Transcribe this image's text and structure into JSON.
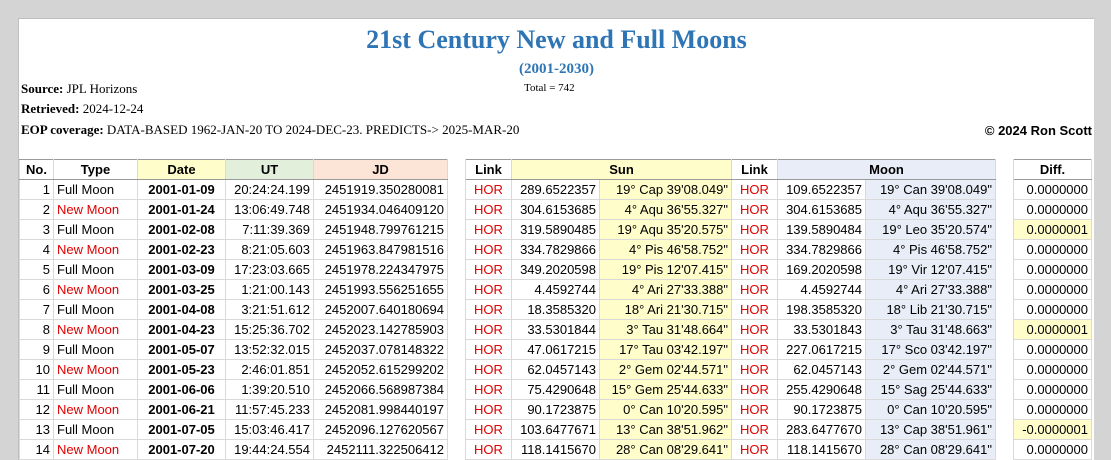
{
  "title": "21st Century New and Full Moons",
  "subtitle": "(2001-2030)",
  "total": "Total = 742",
  "source_label": "Source:",
  "source_value": "JPL Horizons",
  "retrieved_label": "Retrieved:",
  "retrieved_value": "2024-12-24",
  "eop_label": "EOP coverage:",
  "eop_value": "DATA-BASED 1962-JAN-20 TO 2024-DEC-23. PREDICTS-> 2025-MAR-20",
  "copyright": "© 2024 Ron Scott",
  "headers": {
    "no": "No.",
    "type": "Type",
    "date": "Date",
    "ut": "UT",
    "jd": "JD",
    "link1": "Link",
    "sun": "Sun",
    "link2": "Link",
    "moon": "Moon",
    "diff": "Diff."
  },
  "rows": [
    {
      "no": "1",
      "type": "Full Moon",
      "date": "2001-01-09",
      "ut": "20:24:24.199",
      "jd": "2451919.350280081",
      "link1": "HOR",
      "sun_deg": "289.6522357",
      "sun_pos": "19° Cap 39'08.049\"",
      "link2": "HOR",
      "moon_deg": "109.6522357",
      "moon_pos": "19° Can 39'08.049\"",
      "diff": "0.0000000"
    },
    {
      "no": "2",
      "type": "New Moon",
      "date": "2001-01-24",
      "ut": "13:06:49.748",
      "jd": "2451934.046409120",
      "link1": "HOR",
      "sun_deg": "304.6153685",
      "sun_pos": "4° Aqu 36'55.327\"",
      "link2": "HOR",
      "moon_deg": "304.6153685",
      "moon_pos": "4° Aqu 36'55.327\"",
      "diff": "0.0000000"
    },
    {
      "no": "3",
      "type": "Full Moon",
      "date": "2001-02-08",
      "ut": "7:11:39.369",
      "jd": "2451948.799761215",
      "link1": "HOR",
      "sun_deg": "319.5890485",
      "sun_pos": "19° Aqu 35'20.575\"",
      "link2": "HOR",
      "moon_deg": "139.5890484",
      "moon_pos": "19° Leo 35'20.574\"",
      "diff": "0.0000001"
    },
    {
      "no": "4",
      "type": "New Moon",
      "date": "2001-02-23",
      "ut": "8:21:05.603",
      "jd": "2451963.847981516",
      "link1": "HOR",
      "sun_deg": "334.7829866",
      "sun_pos": "4° Pis 46'58.752\"",
      "link2": "HOR",
      "moon_deg": "334.7829866",
      "moon_pos": "4° Pis 46'58.752\"",
      "diff": "0.0000000"
    },
    {
      "no": "5",
      "type": "Full Moon",
      "date": "2001-03-09",
      "ut": "17:23:03.665",
      "jd": "2451978.224347975",
      "link1": "HOR",
      "sun_deg": "349.2020598",
      "sun_pos": "19° Pis 12'07.415\"",
      "link2": "HOR",
      "moon_deg": "169.2020598",
      "moon_pos": "19° Vir 12'07.415\"",
      "diff": "0.0000000"
    },
    {
      "no": "6",
      "type": "New Moon",
      "date": "2001-03-25",
      "ut": "1:21:00.143",
      "jd": "2451993.556251655",
      "link1": "HOR",
      "sun_deg": "4.4592744",
      "sun_pos": "4° Ari 27'33.388\"",
      "link2": "HOR",
      "moon_deg": "4.4592744",
      "moon_pos": "4° Ari 27'33.388\"",
      "diff": "0.0000000"
    },
    {
      "no": "7",
      "type": "Full Moon",
      "date": "2001-04-08",
      "ut": "3:21:51.612",
      "jd": "2452007.640180694",
      "link1": "HOR",
      "sun_deg": "18.3585320",
      "sun_pos": "18° Ari 21'30.715\"",
      "link2": "HOR",
      "moon_deg": "198.3585320",
      "moon_pos": "18° Lib 21'30.715\"",
      "diff": "0.0000000"
    },
    {
      "no": "8",
      "type": "New Moon",
      "date": "2001-04-23",
      "ut": "15:25:36.702",
      "jd": "2452023.142785903",
      "link1": "HOR",
      "sun_deg": "33.5301844",
      "sun_pos": "3° Tau 31'48.664\"",
      "link2": "HOR",
      "moon_deg": "33.5301843",
      "moon_pos": "3° Tau 31'48.663\"",
      "diff": "0.0000001"
    },
    {
      "no": "9",
      "type": "Full Moon",
      "date": "2001-05-07",
      "ut": "13:52:32.015",
      "jd": "2452037.078148322",
      "link1": "HOR",
      "sun_deg": "47.0617215",
      "sun_pos": "17° Tau 03'42.197\"",
      "link2": "HOR",
      "moon_deg": "227.0617215",
      "moon_pos": "17° Sco 03'42.197\"",
      "diff": "0.0000000"
    },
    {
      "no": "10",
      "type": "New Moon",
      "date": "2001-05-23",
      "ut": "2:46:01.851",
      "jd": "2452052.615299202",
      "link1": "HOR",
      "sun_deg": "62.0457143",
      "sun_pos": "2° Gem 02'44.571\"",
      "link2": "HOR",
      "moon_deg": "62.0457143",
      "moon_pos": "2° Gem 02'44.571\"",
      "diff": "0.0000000"
    },
    {
      "no": "11",
      "type": "Full Moon",
      "date": "2001-06-06",
      "ut": "1:39:20.510",
      "jd": "2452066.568987384",
      "link1": "HOR",
      "sun_deg": "75.4290648",
      "sun_pos": "15° Gem 25'44.633\"",
      "link2": "HOR",
      "moon_deg": "255.4290648",
      "moon_pos": "15° Sag 25'44.633\"",
      "diff": "0.0000000"
    },
    {
      "no": "12",
      "type": "New Moon",
      "date": "2001-06-21",
      "ut": "11:57:45.233",
      "jd": "2452081.998440197",
      "link1": "HOR",
      "sun_deg": "90.1723875",
      "sun_pos": "0° Can 10'20.595\"",
      "link2": "HOR",
      "moon_deg": "90.1723875",
      "moon_pos": "0° Can 10'20.595\"",
      "diff": "0.0000000"
    },
    {
      "no": "13",
      "type": "Full Moon",
      "date": "2001-07-05",
      "ut": "15:03:46.417",
      "jd": "2452096.127620567",
      "link1": "HOR",
      "sun_deg": "103.6477671",
      "sun_pos": "13° Can 38'51.962\"",
      "link2": "HOR",
      "moon_deg": "283.6477670",
      "moon_pos": "13° Cap 38'51.961\"",
      "diff": "-0.0000001"
    },
    {
      "no": "14",
      "type": "New Moon",
      "date": "2001-07-20",
      "ut": "19:44:24.554",
      "jd": "2452111.322506412",
      "link1": "HOR",
      "sun_deg": "118.1415670",
      "sun_pos": "28° Can 08'29.641\"",
      "link2": "HOR",
      "moon_deg": "118.1415670",
      "moon_pos": "28° Can 08'29.641\"",
      "diff": "0.0000000"
    }
  ],
  "colors": {
    "title": "#2e75b6",
    "new_moon": "#e00000",
    "link": "#e00000",
    "sun_bg": "#fffdc9",
    "moon_bg": "#e9edf7"
  }
}
